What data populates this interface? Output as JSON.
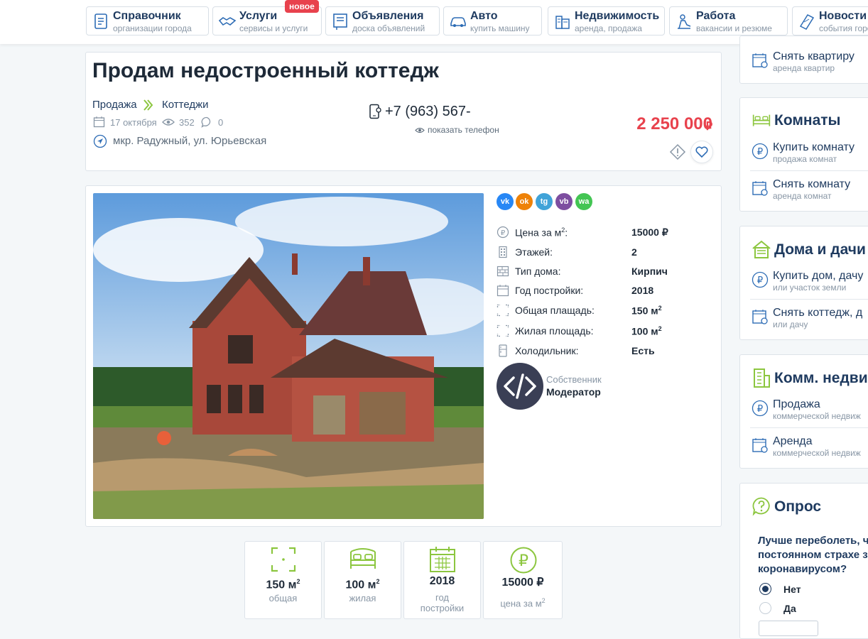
{
  "nav": [
    {
      "title": "Справочник",
      "sub": "организации города",
      "icon": "directory-icon"
    },
    {
      "title": "Услуги",
      "sub": "сервисы и услуги",
      "icon": "handshake-icon",
      "badge": "новое"
    },
    {
      "title": "Объявления",
      "sub": "доска объявлений",
      "icon": "board-icon"
    },
    {
      "title": "Авто",
      "sub": "купить машину",
      "icon": "car-icon"
    },
    {
      "title": "Недвижимость",
      "sub": "аренда, продажа",
      "icon": "buildings-icon"
    },
    {
      "title": "Работа",
      "sub": "вакансии и резюме",
      "icon": "worker-icon"
    },
    {
      "title": "Новости",
      "sub": "события города",
      "icon": "news-icon"
    }
  ],
  "listing": {
    "title": "Продам недостроенный коттедж",
    "breadcrumb": [
      "Продажа",
      "Коттеджи"
    ],
    "date": "17 октября",
    "views": "352",
    "comments": "0",
    "address": "мкр. Радужный, ул. Юрьевская",
    "phone": "+7 (963) 567-",
    "show_phone": "показать телефон",
    "price": "2 250 000",
    "currency": "₽"
  },
  "social": [
    {
      "name": "vk",
      "label": "vk",
      "color": "#2787f5"
    },
    {
      "name": "ok",
      "label": "ok",
      "color": "#ee8208"
    },
    {
      "name": "telegram",
      "label": "tg",
      "color": "#40a3d8"
    },
    {
      "name": "viber",
      "label": "vb",
      "color": "#7d4ea0"
    },
    {
      "name": "whatsapp",
      "label": "wa",
      "color": "#43c553"
    }
  ],
  "props": [
    {
      "label": "Цена за м",
      "sup": "2",
      "suffix": ":",
      "value": "15000 ₽",
      "vsup": "",
      "icon": "ruble-circle-icon"
    },
    {
      "label": "Этажей:",
      "sup": "",
      "suffix": "",
      "value": "2",
      "vsup": "",
      "icon": "floors-icon"
    },
    {
      "label": "Тип дома:",
      "sup": "",
      "suffix": "",
      "value": "Кирпич",
      "vsup": "",
      "icon": "brick-icon"
    },
    {
      "label": "Год постройки:",
      "sup": "",
      "suffix": "",
      "value": "2018",
      "vsup": "",
      "icon": "calendar-icon"
    },
    {
      "label": "Общая плащадь:",
      "sup": "",
      "suffix": "",
      "value": "150 м",
      "vsup": "2",
      "icon": "area-icon"
    },
    {
      "label": "Жилая площадь:",
      "sup": "",
      "suffix": "",
      "value": "100 м",
      "vsup": "2",
      "icon": "area-icon"
    },
    {
      "label": "Холодильник:",
      "sup": "",
      "suffix": "",
      "value": "Есть",
      "vsup": "",
      "icon": "fridge-icon"
    }
  ],
  "owner": {
    "role": "Собственник",
    "name": "Модератор"
  },
  "stats": [
    {
      "value": "150 м",
      "sup": "2",
      "label": "общая",
      "lsup": "",
      "icon": "area-icon"
    },
    {
      "value": "100 м",
      "sup": "2",
      "label": "жилая",
      "lsup": "",
      "icon": "bed-icon"
    },
    {
      "value": "2018",
      "sup": "",
      "label": "год постройки",
      "lsup": "",
      "icon": "calendar-icon"
    },
    {
      "value": "15000 ₽",
      "sup": "",
      "label": "цена за м",
      "lsup": "2",
      "icon": "ruble-circle-icon"
    }
  ],
  "sidebar": {
    "rent_top": {
      "title": "Снять квартиру",
      "sub": "аренда квартир"
    },
    "rooms": {
      "heading": "Комнаты",
      "items": [
        {
          "title": "Купить комнату",
          "sub": "продажа комнат",
          "icon": "ruble-circle-icon"
        },
        {
          "title": "Снять комнату",
          "sub": "аренда комнат",
          "icon": "calendar-icon"
        }
      ]
    },
    "houses": {
      "heading": "Дома и дачи",
      "items": [
        {
          "title": "Купить дом, дачу",
          "sub": "или участок земли",
          "icon": "ruble-circle-icon"
        },
        {
          "title": "Снять коттедж, д",
          "sub": "или дачу",
          "icon": "calendar-icon"
        }
      ]
    },
    "commercial": {
      "heading": "Комм. недви",
      "items": [
        {
          "title": "Продажа",
          "sub": "коммерческой недвиж",
          "icon": "ruble-circle-icon"
        },
        {
          "title": "Аренда",
          "sub": "коммерческой недвиж",
          "icon": "calendar-icon"
        }
      ]
    },
    "poll": {
      "heading": "Опрос",
      "question": "Лучше переболеть, ч постоянном страхе з коронавирусом?",
      "options": [
        "Нет",
        "Да"
      ],
      "selected": 0
    }
  },
  "colors": {
    "accent": "#1e3a5f",
    "green": "#8cc63f",
    "price": "#e8424d"
  }
}
